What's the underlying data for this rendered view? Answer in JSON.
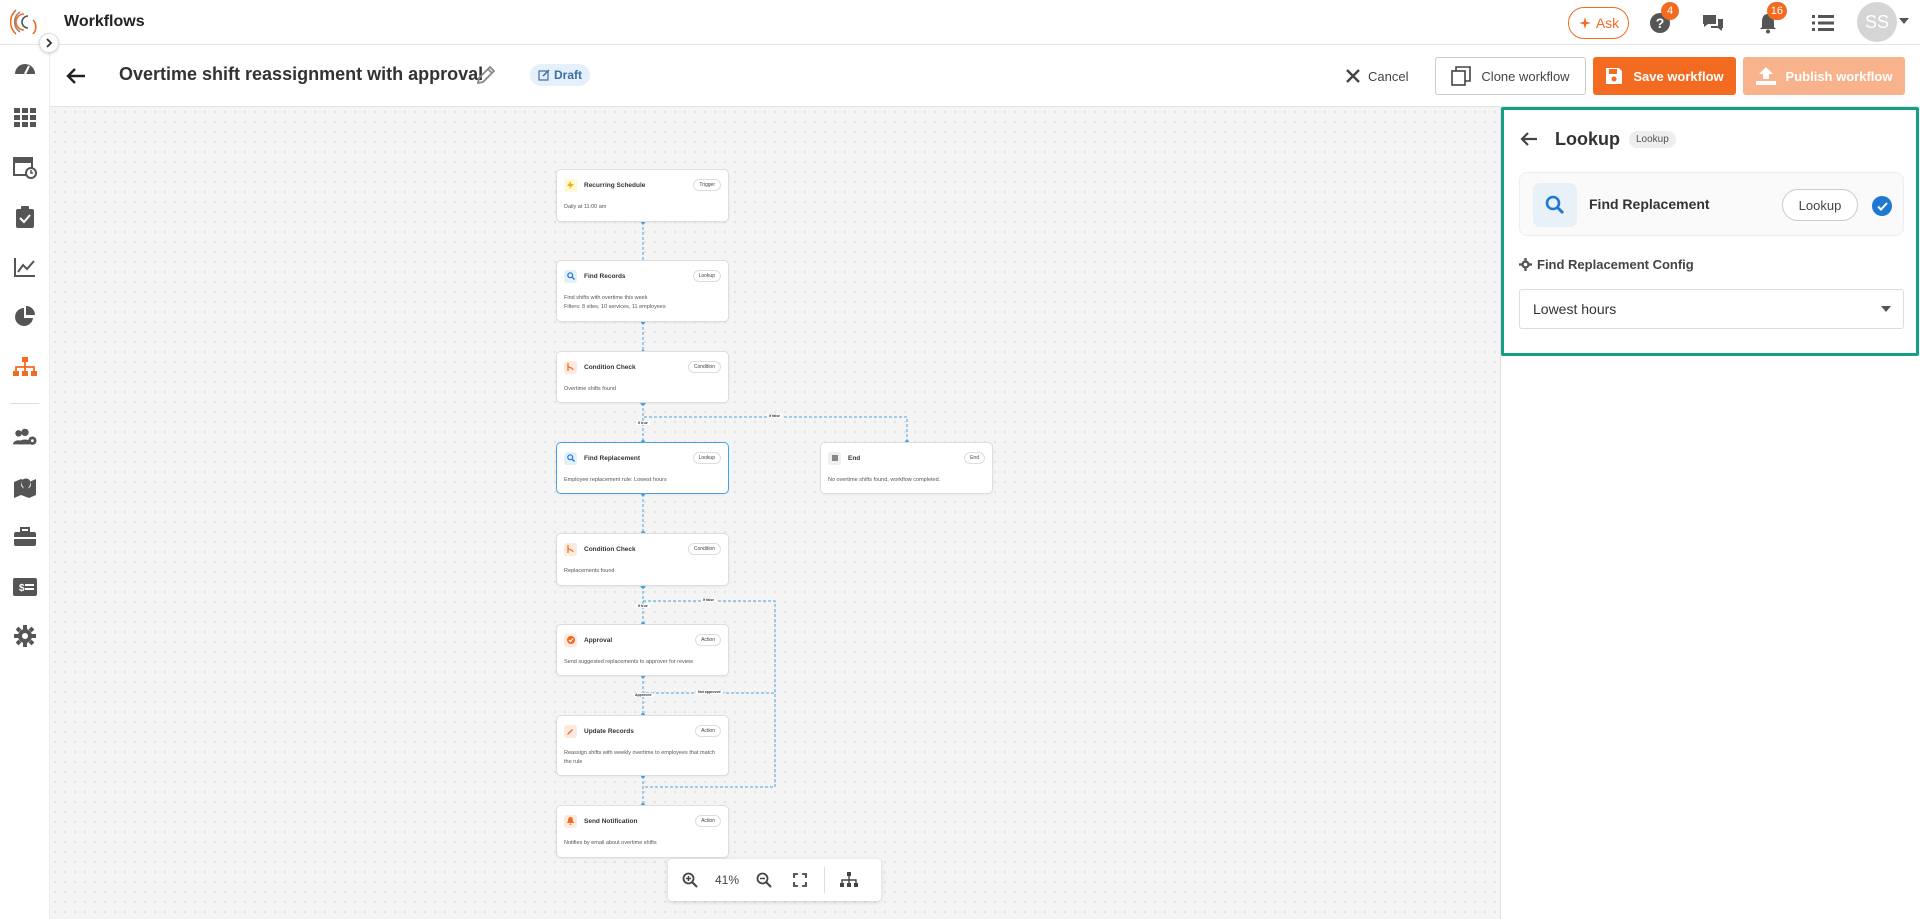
{
  "app": {
    "title": "Workflows"
  },
  "header": {
    "ask_label": "Ask",
    "help_badge": "4",
    "notif_badge": "16",
    "avatar_initials": "SS"
  },
  "workflow": {
    "title": "Overtime shift reassignment with approval",
    "status": "Draft",
    "cancel_label": "Cancel",
    "clone_label": "Clone workflow",
    "save_label": "Save workflow",
    "publish_label": "Publish workflow"
  },
  "canvas": {
    "zoom": "41%",
    "nodes": [
      {
        "title": "Recurring Schedule",
        "tag": "Trigger",
        "desc": "Daily at 11:00 am",
        "icon": "bolt-icon"
      },
      {
        "title": "Find Records",
        "tag": "Lookup",
        "desc": "Find shifts with overtime this week\nFilters: 8 sites, 10 services, 11 employees",
        "icon": "search-icon"
      },
      {
        "title": "Condition Check",
        "tag": "Condition",
        "desc": "Overtime shifts found",
        "icon": "branch-icon"
      },
      {
        "title": "Find Replacement",
        "tag": "Lookup",
        "desc": "Employee replacement rule: Lowest hours",
        "icon": "search-icon"
      },
      {
        "title": "End",
        "tag": "End",
        "desc": "No overtime shifts found, workflow completed.",
        "icon": "stop-icon"
      },
      {
        "title": "Condition Check",
        "tag": "Condition",
        "desc": "Replacements found",
        "icon": "branch-icon"
      },
      {
        "title": "Approval",
        "tag": "Action",
        "desc": "Send suggested replacements to approver for review",
        "icon": "check-circle-icon"
      },
      {
        "title": "Update Records",
        "tag": "Action",
        "desc": "Reassign shifts with weekly overtime to employees that match the rule",
        "icon": "pencil-icon"
      },
      {
        "title": "Send Notification",
        "tag": "Action",
        "desc": "Notifies by email about overtime shifts",
        "icon": "bell-icon"
      }
    ],
    "edge_labels": {
      "if_true_1": "If true",
      "if_false_1": "If false",
      "if_true_2": "If true",
      "if_false_2": "If false",
      "approved": "Approved",
      "not_approved": "Not approved"
    }
  },
  "panel": {
    "title": "Lookup",
    "type_badge": "Lookup",
    "node_name": "Find Replacement",
    "node_tag": "Lookup",
    "config_label": "Find Replacement Config",
    "config_value": "Lowest hours"
  },
  "colors": {
    "brand": "#f26b21",
    "highlight": "#13a085",
    "selected": "#4aa3df",
    "check": "#1f78d1"
  }
}
